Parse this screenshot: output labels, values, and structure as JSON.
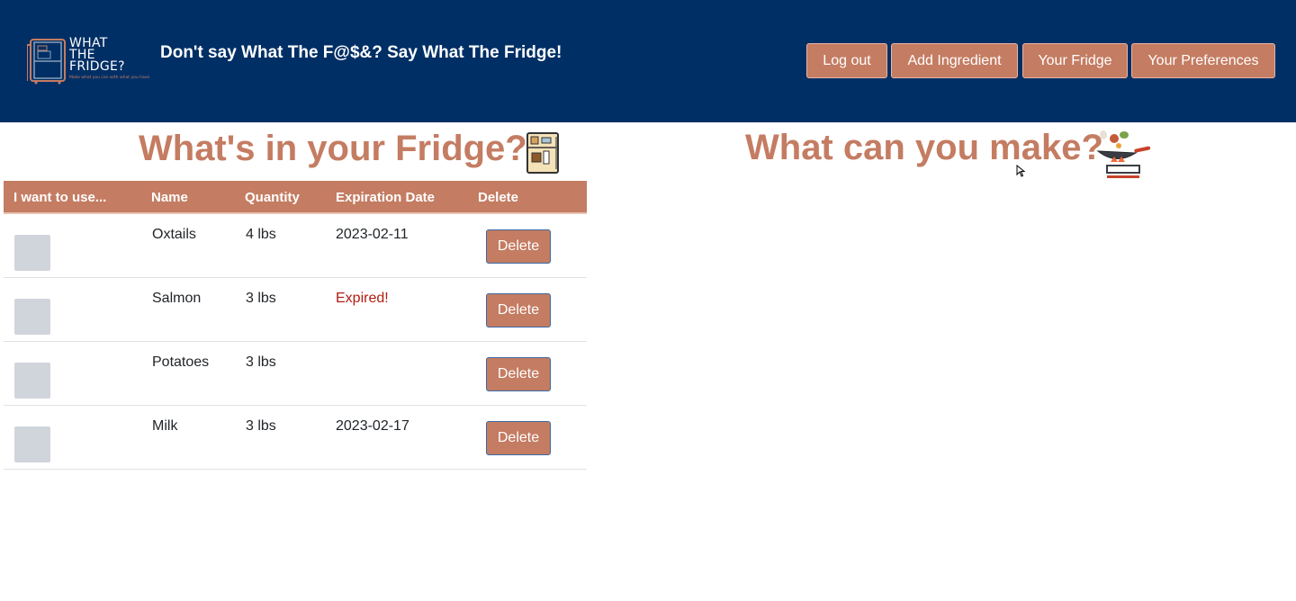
{
  "header": {
    "logo": {
      "line1": "WHAT",
      "line2": "THE",
      "line3": "FRIDGE?",
      "tagline": "Make what you can with what you have"
    },
    "tagline": "Don't say What The F@$&? Say What The Fridge!",
    "nav": [
      "Log out",
      "Add Ingredient",
      "Your Fridge",
      "Your Preferences"
    ]
  },
  "fridge": {
    "heading": "What's in your Fridge?",
    "columns": [
      "I want to use...",
      "Name",
      "Quantity",
      "Expiration Date",
      "Delete"
    ],
    "rows": [
      {
        "name": "Oxtails",
        "quantity": "4 lbs",
        "expiration": "2023-02-11",
        "expired": false,
        "delete": "Delete"
      },
      {
        "name": "Salmon",
        "quantity": "3 lbs",
        "expiration": "Expired!",
        "expired": true,
        "delete": "Delete"
      },
      {
        "name": "Potatoes",
        "quantity": "3 lbs",
        "expiration": "",
        "expired": false,
        "delete": "Delete"
      },
      {
        "name": "Milk",
        "quantity": "3 lbs",
        "expiration": "2023-02-17",
        "expired": false,
        "delete": "Delete"
      }
    ]
  },
  "recipes": {
    "heading": "What can you make?"
  },
  "icons": {
    "logo": "fridge-logo-icon",
    "fridge": "fridge-icon",
    "pan": "frying-pan-icon",
    "cursor": "mouse-cursor-icon"
  },
  "colors": {
    "header_bg": "#002f65",
    "accent": "#c47c62",
    "expired": "#b11c12",
    "checkbox": "#d0d5dc"
  }
}
